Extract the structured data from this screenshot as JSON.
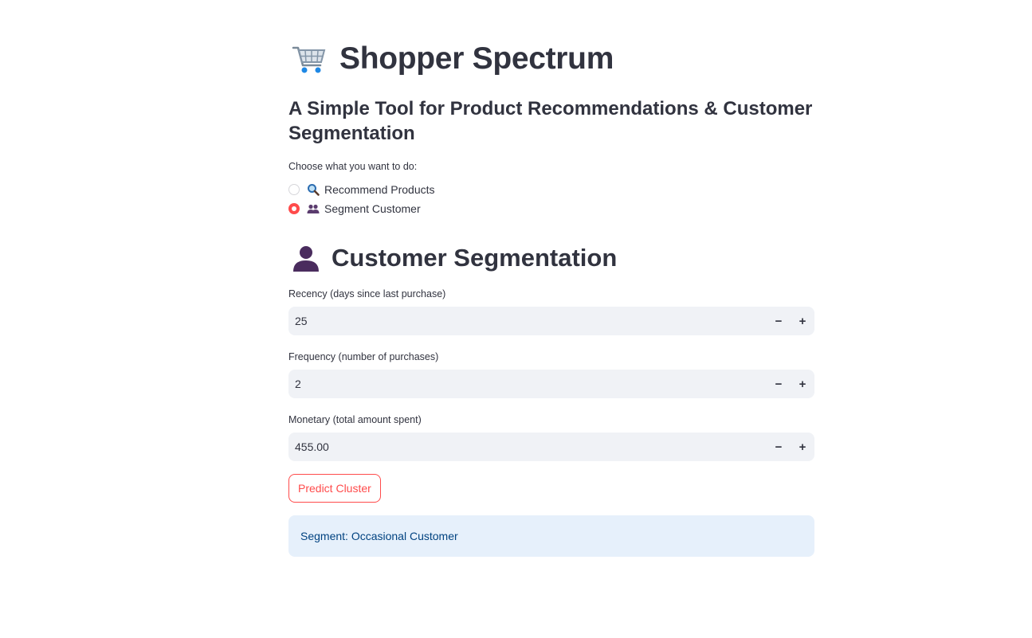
{
  "header": {
    "title": "Shopper Spectrum",
    "title_icon": "shopping-cart-icon",
    "subtitle": "A Simple Tool for Product Recommendations & Customer Segmentation"
  },
  "mode_selector": {
    "label": "Choose what you want to do:",
    "options": [
      {
        "label": "Recommend Products",
        "icon": "magnifying-glass-icon",
        "selected": false
      },
      {
        "label": "Segment Customer",
        "icon": "people-icon",
        "selected": true
      }
    ]
  },
  "segmentation": {
    "title": "Customer Segmentation",
    "title_icon": "person-silhouette-icon",
    "fields": [
      {
        "label": "Recency (days since last purchase)",
        "value": "25"
      },
      {
        "label": "Frequency (number of purchases)",
        "value": "2"
      },
      {
        "label": "Monetary (total amount spent)",
        "value": "455.00"
      }
    ],
    "step_minus": "−",
    "step_plus": "+",
    "predict_label": "Predict Cluster",
    "result": "Segment: Occasional Customer"
  },
  "colors": {
    "accent": "#ff4b4b",
    "input_bg": "#f0f2f6",
    "info_bg": "#e6f0fb",
    "info_text": "#004280",
    "text": "#31333f"
  }
}
